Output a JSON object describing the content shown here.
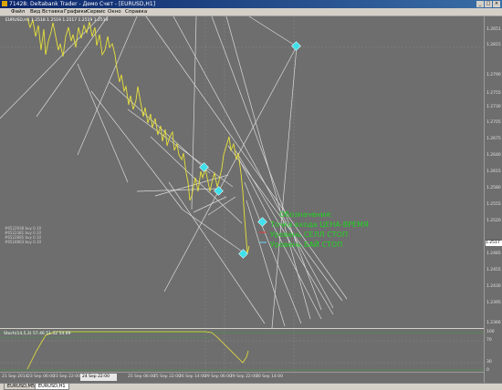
{
  "window": {
    "title": "71428: Deltabank Trader - Демо Счет - [EURUSD,H1]"
  },
  "menu": [
    "Файл",
    "Вид",
    "Вставка",
    "Графики",
    "Сервис",
    "Окно",
    "Справка"
  ],
  "chart": {
    "label": "EURUSD,H1  1.2518 1.2519 1.2517 1.2519 1.2519",
    "orders": [
      "#6522938 buy 0.10",
      "#6522381 buy 0.10",
      "#6522885 buy 0.10",
      "#6524863 buy 0.10"
    ],
    "price_ticks": [
      "1.2651",
      "1.2815",
      "1.2790",
      "1.2755",
      "1.2730",
      "1.2705",
      "1.2675",
      "1.2640",
      "1.2615",
      "1.2580",
      "1.2555",
      "1.2520",
      "1.2485",
      "1.2455",
      "1.2430",
      "1.2395",
      "1.2366"
    ],
    "current_price": "1.2517",
    "legend": {
      "title": "Обозначения:",
      "entry": "Точка входа ЦЕНА-ВРЕМЯ",
      "sell": "Уровень СЕЛЛ СТОП",
      "buy": "Уровень БАЙ СТОП"
    },
    "colors": {
      "price": "#e8e23a",
      "lines": "#e6e6e6",
      "marker": "#3ee0ea",
      "legend": "#21d321",
      "sell_line": "#e83a3a",
      "buy_line": "#6ad6ff"
    }
  },
  "indicator": {
    "label": "Stoch(14,5,3) 57.46 51.32 54.69",
    "ticks": [
      "100",
      "70",
      "30",
      "0"
    ]
  },
  "time_axis": [
    "21 Sep 2014",
    "23 Sep 06:00",
    "23 Sep 22:00",
    "24 Sep 14:00",
    "25 Sep 06:00",
    "25 Sep 22:00",
    "26 Sep 14:00",
    "29 Sep 06:00",
    "29 Sep 22:00",
    "30 Sep 14:00"
  ],
  "time_highlight": "24 Sep 22:00",
  "tabs": [
    "EURUSD,M5",
    "EURUSD,H1"
  ],
  "active_tab": 1
}
